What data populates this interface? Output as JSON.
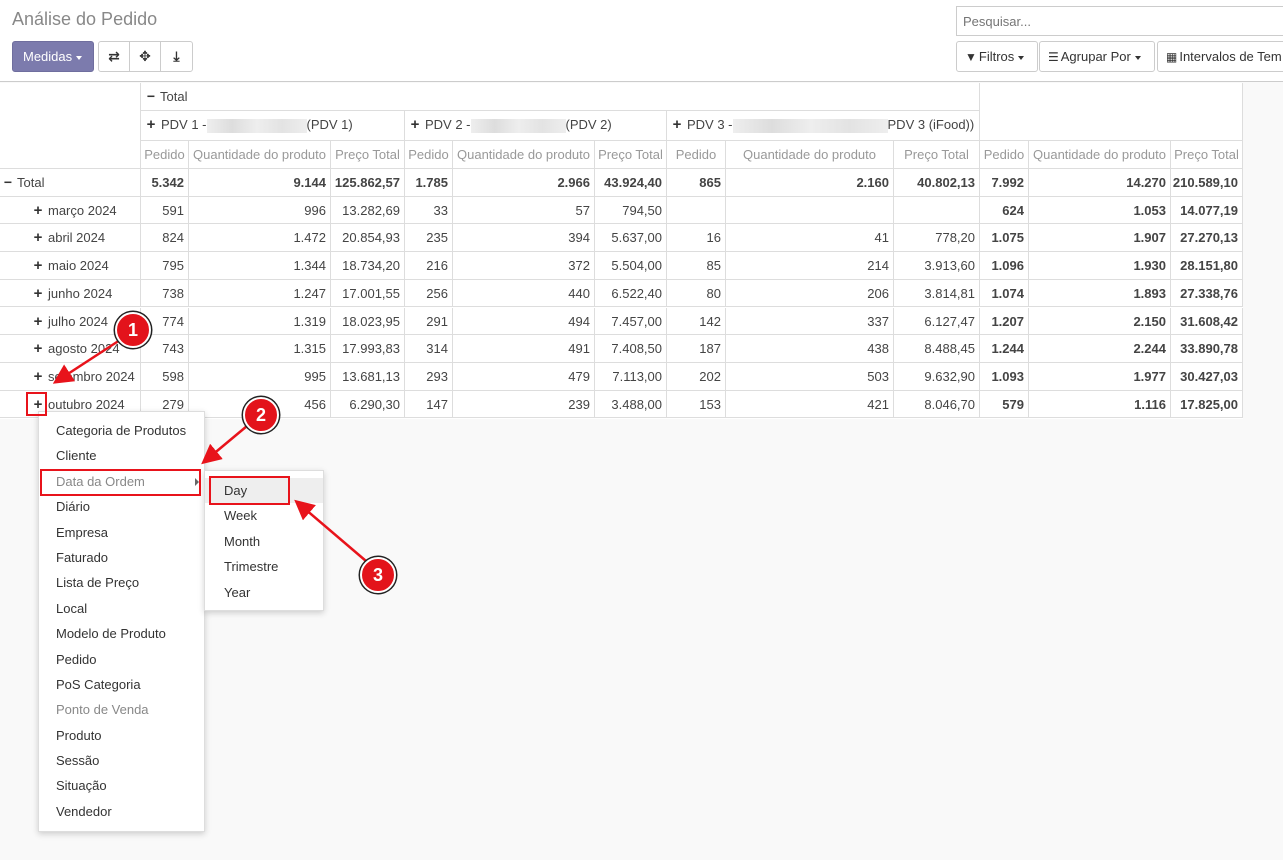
{
  "header": {
    "title": "Análise do Pedido",
    "search_placeholder": "Pesquisar...",
    "measures_label": "Medidas",
    "filters_label": "Filtros",
    "groupby_label": "Agrupar Por",
    "intervals_label": "Intervalos de Tem"
  },
  "pivot": {
    "col_total": "Total",
    "groups": [
      {
        "prefix": "PDV 1 -",
        "suffix": "(PDV 1)"
      },
      {
        "prefix": "PDV 2 -",
        "suffix": "(PDV 2)"
      },
      {
        "prefix": "PDV 3 -",
        "suffix": "PDV 3 (iFood))"
      }
    ],
    "measures": [
      "Pedido",
      "Quantidade do produto",
      "Preço Total"
    ],
    "rows": [
      {
        "label": "Total",
        "values": [
          "5.342",
          "9.144",
          "125.862,57",
          "1.785",
          "2.966",
          "43.924,40",
          "865",
          "2.160",
          "40.802,13",
          "7.992",
          "14.270",
          "210.589,10"
        ]
      },
      {
        "label": "março 2024",
        "values": [
          "591",
          "996",
          "13.282,69",
          "33",
          "57",
          "794,50",
          "",
          "",
          "",
          "624",
          "1.053",
          "14.077,19"
        ]
      },
      {
        "label": "abril 2024",
        "values": [
          "824",
          "1.472",
          "20.854,93",
          "235",
          "394",
          "5.637,00",
          "16",
          "41",
          "778,20",
          "1.075",
          "1.907",
          "27.270,13"
        ]
      },
      {
        "label": "maio 2024",
        "values": [
          "795",
          "1.344",
          "18.734,20",
          "216",
          "372",
          "5.504,00",
          "85",
          "214",
          "3.913,60",
          "1.096",
          "1.930",
          "28.151,80"
        ]
      },
      {
        "label": "junho 2024",
        "values": [
          "738",
          "1.247",
          "17.001,55",
          "256",
          "440",
          "6.522,40",
          "80",
          "206",
          "3.814,81",
          "1.074",
          "1.893",
          "27.338,76"
        ]
      },
      {
        "label": "julho 2024",
        "values": [
          "774",
          "1.319",
          "18.023,95",
          "291",
          "494",
          "7.457,00",
          "142",
          "337",
          "6.127,47",
          "1.207",
          "2.150",
          "31.608,42"
        ]
      },
      {
        "label": "agosto 2024",
        "values": [
          "743",
          "1.315",
          "17.993,83",
          "314",
          "491",
          "7.408,50",
          "187",
          "438",
          "8.488,45",
          "1.244",
          "2.244",
          "33.890,78"
        ]
      },
      {
        "label": "setembro 2024",
        "values": [
          "598",
          "995",
          "13.681,13",
          "293",
          "479",
          "7.113,00",
          "202",
          "503",
          "9.632,90",
          "1.093",
          "1.977",
          "30.427,03"
        ]
      },
      {
        "label": "outubro 2024",
        "values": [
          "279",
          "456",
          "6.290,30",
          "147",
          "239",
          "3.488,00",
          "153",
          "421",
          "8.046,70",
          "579",
          "1.116",
          "17.825,00"
        ]
      }
    ]
  },
  "groupby_menu": {
    "items": [
      "Categoria de Produtos",
      "Cliente",
      "Data da Ordem",
      "Diário",
      "Empresa",
      "Faturado",
      "Lista de Preço",
      "Local",
      "Modelo de Produto",
      "Pedido",
      "PoS Categoria",
      "Ponto de Venda",
      "Produto",
      "Sessão",
      "Situação",
      "Vendedor"
    ],
    "submenu": [
      "Day",
      "Week",
      "Month",
      "Trimestre",
      "Year"
    ]
  },
  "annotations": {
    "badge1": "1",
    "badge2": "2",
    "badge3": "3",
    "accent": "#e3131b"
  }
}
